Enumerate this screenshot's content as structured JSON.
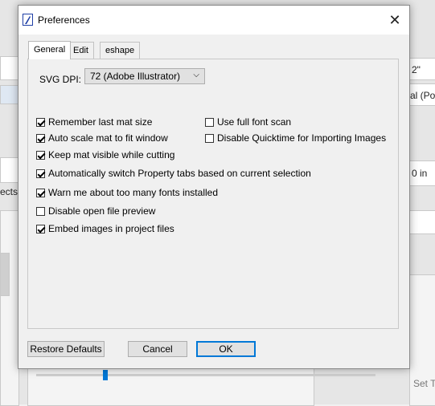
{
  "background": {
    "items": [
      "2\"",
      "al (Portr",
      "0 in",
      "ects",
      "Set T"
    ]
  },
  "dialog": {
    "title": "Preferences",
    "close_glyph": "✕"
  },
  "tabs": [
    "General",
    "Edit",
    "eshape"
  ],
  "general": {
    "svg_dpi_label": "SVG DPI:",
    "svg_dpi_value": "72 (Adobe Illustrator)"
  },
  "options": {
    "left": [
      {
        "label": "Remember last mat size",
        "checked": true
      },
      {
        "label": "Auto scale mat to fit window",
        "checked": true
      },
      {
        "label": "Keep mat visible while cutting",
        "checked": true
      },
      {
        "label": "Automatically switch Property tabs based on current selection",
        "checked": true
      },
      {
        "label": "Warn me about too many fonts installed",
        "checked": true
      },
      {
        "label": "Disable open file preview",
        "checked": false
      },
      {
        "label": "Embed images in project files",
        "checked": true
      }
    ],
    "right": [
      {
        "label": "Use full font scan",
        "checked": false
      },
      {
        "label": "Disable Quicktime for Importing Images",
        "checked": false
      }
    ]
  },
  "buttons": {
    "restore_defaults": "Restore Defaults",
    "cancel": "Cancel",
    "ok": "OK"
  }
}
